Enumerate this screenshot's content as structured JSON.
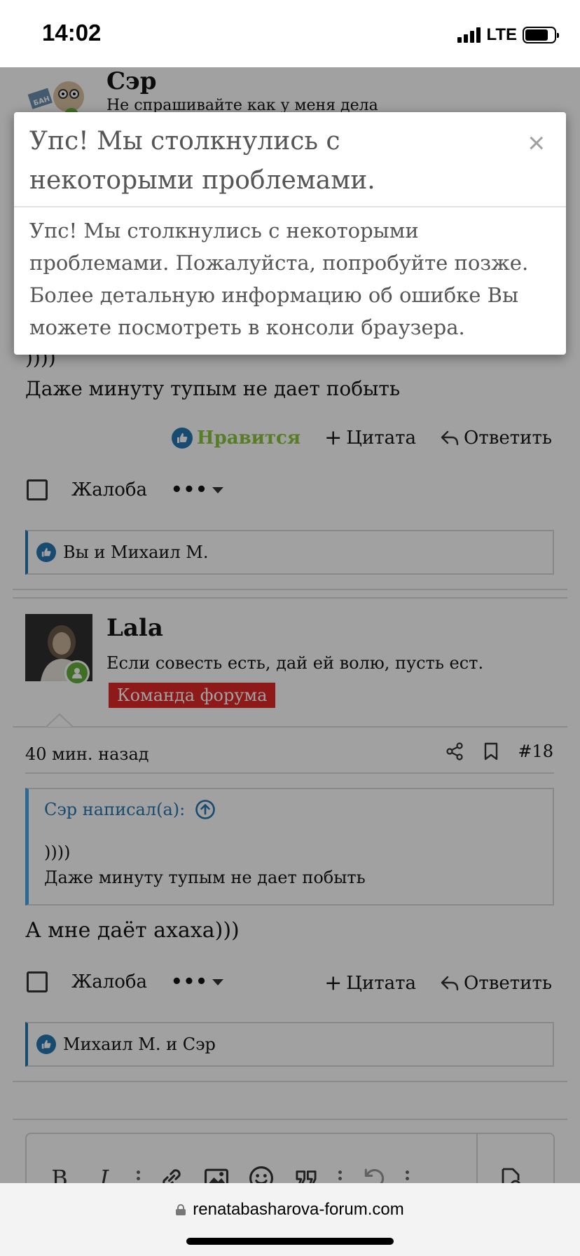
{
  "status_bar": {
    "time": "14:02",
    "network": "LTE"
  },
  "post_top": {
    "author": "Сэр",
    "signature": "Не спрашивайте как у меня дела",
    "avatar_sign": "БАН",
    "message_line1": "))))",
    "message_line2": "Даже минуту тупым не дает побыть",
    "like_label": "Нравится",
    "quote_label": "Цитата",
    "reply_label": "Ответить",
    "report_label": "Жалоба",
    "likes_text": "Вы и Михаил М."
  },
  "post_second": {
    "author": "Lala",
    "signature": "Если совесть есть, дай ей волю, пусть ест.",
    "badge": "Команда форума",
    "time": "40 мин. назад",
    "post_number": "#18",
    "quote_head": "Сэр написал(а):",
    "quote_line1": "))))",
    "quote_line2": "Даже минуту тупым не дает побыть",
    "reply_text": "А мне даёт ахаха)))",
    "quote_label": "Цитата",
    "reply_label": "Ответить",
    "report_label": "Жалоба",
    "likes_text": "Михаил М. и Сэр"
  },
  "editor": {
    "tools": [
      "bold-icon",
      "italic-icon",
      "more-icon",
      "link-icon",
      "image-icon",
      "smiley-icon",
      "quote-icon",
      "more-icon",
      "undo-icon",
      "more-icon",
      "preview-icon"
    ]
  },
  "modal": {
    "title": "Упс! Мы столкнулись с некоторыми проблемами.",
    "close": "×",
    "body": "Упс! Мы столкнулись с некоторыми проблемами. Пожалуйста, попробуйте позже. Более детальную информацию об ошибке Вы можете посмотреть в консоли браузера."
  },
  "browser": {
    "url": "renatabasharova-forum.com"
  },
  "colors": {
    "like_blue": "#2577b1",
    "like_green": "#8cc63f",
    "badge_red": "#df2828",
    "online_green": "#63b03c"
  }
}
